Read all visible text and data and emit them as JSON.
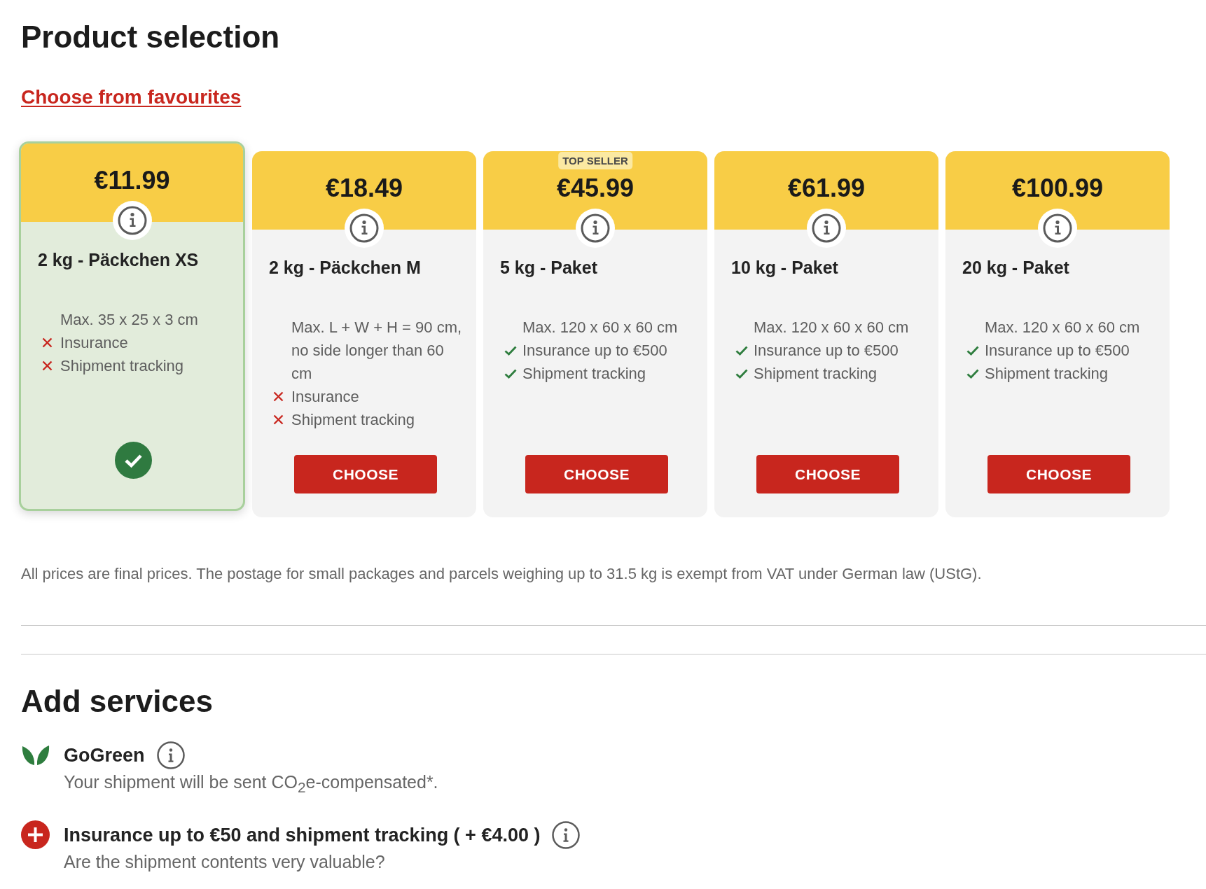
{
  "heading": "Product selection",
  "favourites_link": "Choose from favourites",
  "products": [
    {
      "price": "€11.99",
      "name": "2 kg - Päckchen XS",
      "selected": true,
      "features": [
        {
          "kind": "info",
          "text": "Max. 35 x 25 x 3 cm"
        },
        {
          "kind": "excluded",
          "text": "Insurance"
        },
        {
          "kind": "excluded",
          "text": "Shipment tracking"
        }
      ]
    },
    {
      "price": "€18.49",
      "name": "2 kg - Päckchen M",
      "selected": false,
      "features": [
        {
          "kind": "info",
          "text": "Max. L + W + H = 90 cm, no side longer than 60 cm"
        },
        {
          "kind": "excluded",
          "text": "Insurance"
        },
        {
          "kind": "excluded",
          "text": "Shipment tracking"
        }
      ],
      "button": "CHOOSE"
    },
    {
      "badge": "TOP SELLER",
      "price": "€45.99",
      "name": "5 kg - Paket",
      "selected": false,
      "features": [
        {
          "kind": "info",
          "text": "Max. 120 x 60 x 60 cm"
        },
        {
          "kind": "included",
          "text": "Insurance up to €500"
        },
        {
          "kind": "included",
          "text": "Shipment tracking"
        }
      ],
      "button": "CHOOSE"
    },
    {
      "price": "€61.99",
      "name": "10 kg - Paket",
      "selected": false,
      "features": [
        {
          "kind": "info",
          "text": "Max. 120 x 60 x 60 cm"
        },
        {
          "kind": "included",
          "text": "Insurance up to €500"
        },
        {
          "kind": "included",
          "text": "Shipment tracking"
        }
      ],
      "button": "CHOOSE"
    },
    {
      "price": "€100.99",
      "name": "20 kg - Paket",
      "selected": false,
      "features": [
        {
          "kind": "info",
          "text": "Max. 120 x 60 x 60 cm"
        },
        {
          "kind": "included",
          "text": "Insurance up to €500"
        },
        {
          "kind": "included",
          "text": "Shipment tracking"
        }
      ],
      "button": "CHOOSE"
    }
  ],
  "footnote": "All prices are final prices. The postage for small packages and parcels weighing up to 31.5 kg is exempt from VAT under German law (UStG).",
  "services_heading": "Add services",
  "services": [
    {
      "kind": "leaf",
      "title": "GoGreen",
      "description": "Your shipment will be sent CO$_{2}$e-compensated*."
    },
    {
      "kind": "add",
      "title": "Insurance up to €50 and shipment tracking ( + €4.00 )",
      "description": "Are the shipment contents very valuable?"
    }
  ]
}
